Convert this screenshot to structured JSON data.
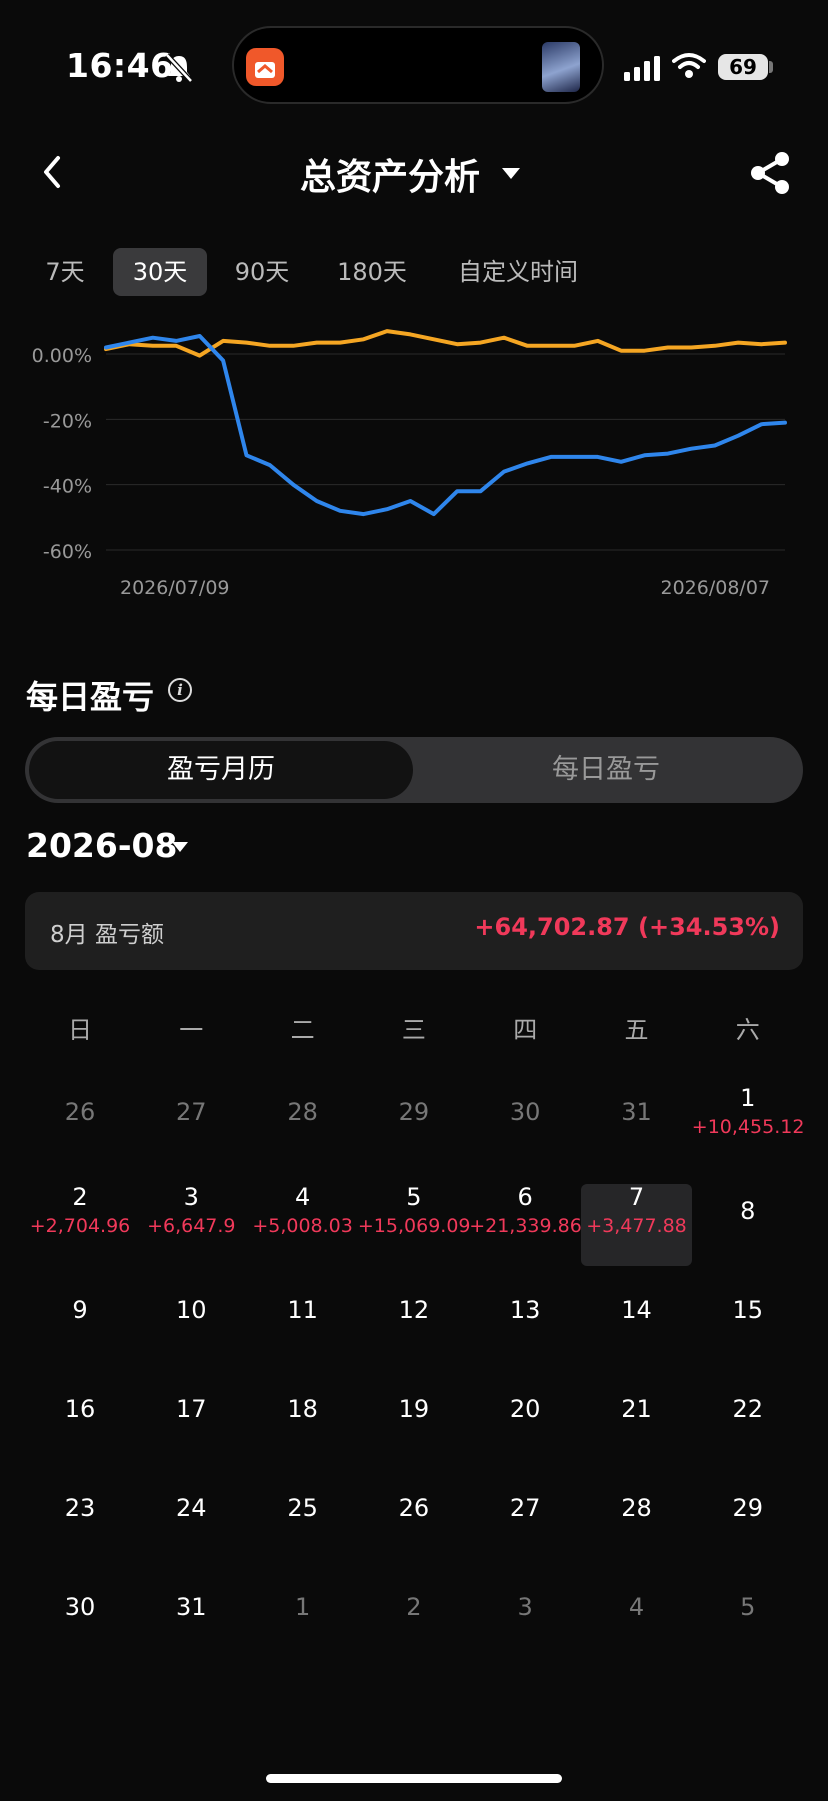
{
  "status": {
    "time": "16:46",
    "battery": "69"
  },
  "header": {
    "title": "总资产分析"
  },
  "ranges": [
    "7天",
    "30天",
    "90天",
    "180天",
    "自定义时间"
  ],
  "active_range": "30天",
  "chart_data": {
    "type": "line",
    "x_start_label": "2026/07/09",
    "x_end_label": "2026/08/07",
    "y_ticks": [
      "0.00%",
      "-20%",
      "-40%",
      "-60%"
    ],
    "ylim": [
      -60,
      8
    ],
    "grid": true,
    "series": [
      {
        "color": "#f5a623",
        "values": [
          1.5,
          3,
          2.5,
          2.5,
          -0.5,
          4,
          3.5,
          2.5,
          2.5,
          3.5,
          3.5,
          4.5,
          7,
          6,
          4.5,
          3,
          3.5,
          5,
          2.5,
          2.5,
          2.5,
          4,
          1,
          1,
          2,
          2,
          2.5,
          3.5,
          3,
          3.5
        ]
      },
      {
        "color": "#2f86ec",
        "values": [
          2,
          3.5,
          5,
          4,
          5.5,
          -2,
          -31,
          -34,
          -40,
          -45,
          -48,
          -49,
          -47.5,
          -45,
          -49,
          -42,
          -42,
          -36,
          -33.5,
          -31.5,
          -31.5,
          -31.5,
          -33,
          -31,
          -30.5,
          -29,
          -28,
          -25,
          -21.5,
          -21
        ]
      }
    ]
  },
  "daily": {
    "title": "每日盈亏",
    "seg_on": "盈亏月历",
    "seg_off": "每日盈亏",
    "month": "2026-08",
    "summary_label": "8月 盈亏额",
    "summary_value": "+64,702.87 (+34.53%)"
  },
  "weekdays": [
    "日",
    "一",
    "二",
    "三",
    "四",
    "五",
    "六"
  ],
  "calendar": [
    [
      {
        "d": "26",
        "o": true
      },
      {
        "d": "27",
        "o": true
      },
      {
        "d": "28",
        "o": true
      },
      {
        "d": "29",
        "o": true
      },
      {
        "d": "30",
        "o": true
      },
      {
        "d": "31",
        "o": true
      },
      {
        "d": "1",
        "p": "+10,455.12"
      }
    ],
    [
      {
        "d": "2",
        "p": "+2,704.96"
      },
      {
        "d": "3",
        "p": "+6,647.9"
      },
      {
        "d": "4",
        "p": "+5,008.03"
      },
      {
        "d": "5",
        "p": "+15,069.09"
      },
      {
        "d": "6",
        "p": "+21,339.86"
      },
      {
        "d": "7",
        "p": "+3,477.88",
        "sel": true
      },
      {
        "d": "8"
      }
    ],
    [
      {
        "d": "9"
      },
      {
        "d": "10"
      },
      {
        "d": "11"
      },
      {
        "d": "12"
      },
      {
        "d": "13"
      },
      {
        "d": "14"
      },
      {
        "d": "15"
      }
    ],
    [
      {
        "d": "16"
      },
      {
        "d": "17"
      },
      {
        "d": "18"
      },
      {
        "d": "19"
      },
      {
        "d": "20"
      },
      {
        "d": "21"
      },
      {
        "d": "22"
      }
    ],
    [
      {
        "d": "23"
      },
      {
        "d": "24"
      },
      {
        "d": "25"
      },
      {
        "d": "26"
      },
      {
        "d": "27"
      },
      {
        "d": "28"
      },
      {
        "d": "29"
      }
    ],
    [
      {
        "d": "30"
      },
      {
        "d": "31"
      },
      {
        "d": "1",
        "o": true
      },
      {
        "d": "2",
        "o": true
      },
      {
        "d": "3",
        "o": true
      },
      {
        "d": "4",
        "o": true
      },
      {
        "d": "5",
        "o": true
      }
    ]
  ]
}
